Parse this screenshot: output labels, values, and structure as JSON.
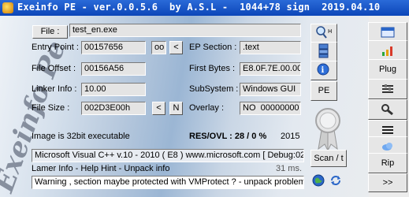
{
  "window": {
    "title": "Exeinfo PE - ver.0.0.5.6  by A.S.L -  1044+78 sign  2019.04.10",
    "watermark": "Exeinfo Pe"
  },
  "file": {
    "button_label": "File :",
    "value": "test_en.exe"
  },
  "entry_point": {
    "label": "Entry Point :",
    "value": "00157656",
    "oo_label": "oo",
    "prev_label": "<"
  },
  "ep_section": {
    "label": "EP Section :",
    "value": ".text"
  },
  "file_offset": {
    "label": "File Offset :",
    "value": "00156A56"
  },
  "first_bytes": {
    "label": "First Bytes :",
    "value": "E8.0F.7E.00.00"
  },
  "linker_info": {
    "label": "Linker Info :",
    "value": "10.00"
  },
  "subsystem": {
    "label": "SubSystem :",
    "value": "Windows GUI"
  },
  "file_size": {
    "label": "File Size :",
    "value": "002D3E00h",
    "prev_label": "<",
    "next_label": "N"
  },
  "overlay": {
    "label": "Overlay :",
    "value": "NO  00000000"
  },
  "info": {
    "image_type": "Image is 32bit executable",
    "res_ovl": "RES/OVL : 28 / 0 %",
    "year": "2015"
  },
  "detect": {
    "compiler": "Microsoft Visual C++ v.10 - 2010 ( E8 ) www.microsoft.com [ Debug:02",
    "hint": "Lamer Info - Help Hint - Unpack info",
    "time": "31 ms.",
    "warning": "Warning , section maybe protected with VMProtect ? - unpack problem"
  },
  "buttons": {
    "pe": "PE",
    "scan": "Scan / t",
    "plug": "Plug",
    "rip": "Rip",
    "next": ">>"
  },
  "colors": {
    "title_bar": "#0c46b8",
    "panel_accent": "#9bb6d4"
  }
}
